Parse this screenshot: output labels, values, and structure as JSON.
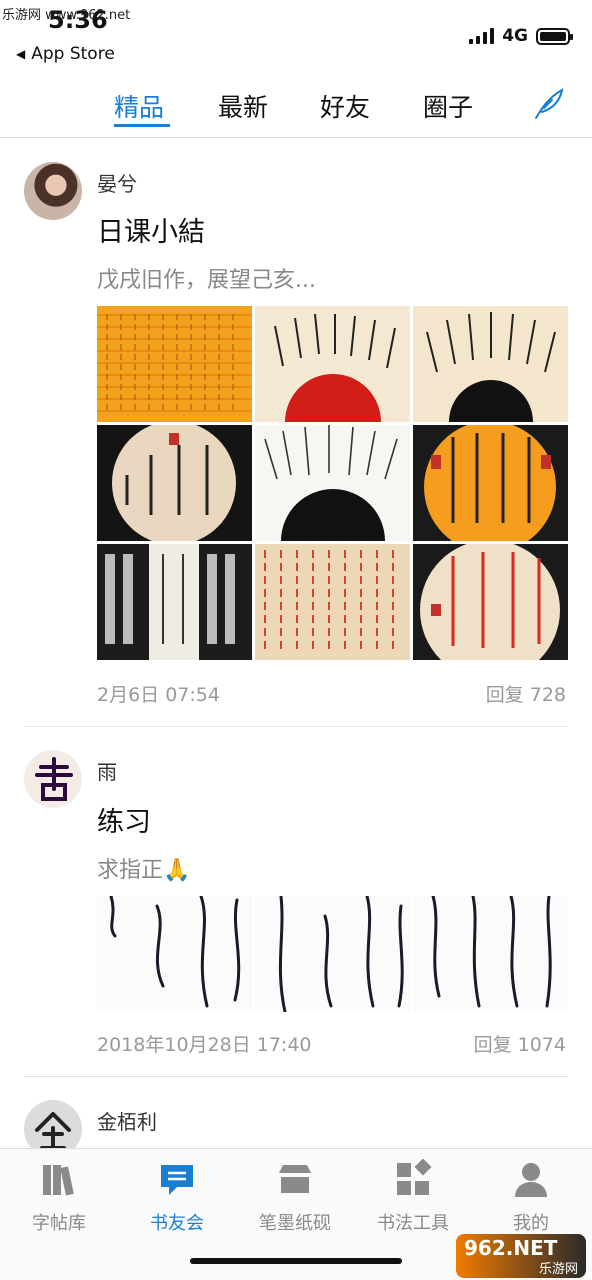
{
  "watermark": {
    "top_left": "乐游网 www.962.net",
    "bottom_right": "962.NET",
    "bottom_right_sub": "乐游网"
  },
  "status_bar": {
    "time": "5:36",
    "network": "4G",
    "back_label": "App Store"
  },
  "tabs": [
    {
      "label": "精品",
      "active": true
    },
    {
      "label": "最新",
      "active": false
    },
    {
      "label": "好友",
      "active": false
    },
    {
      "label": "圈子",
      "active": false
    }
  ],
  "compose_icon": "quill-icon",
  "accent_color": "#1a7fd4",
  "posts": [
    {
      "author": "晏兮",
      "title": "日课小結",
      "excerpt": "戊戌旧作，展望己亥...",
      "date": "2月6日 07:54",
      "replies": "回复 728",
      "images": [
        "orange-grid-calligraphy",
        "fan-calligraphy-red",
        "fan-calligraphy-black",
        "round-calligraphy-墨香",
        "fan-calligraphy-white",
        "round-calligraphy-orange",
        "black-rubbing-calligraphy",
        "red-grid-calligraphy",
        "round-calligraphy-red-text"
      ]
    },
    {
      "author": "雨",
      "title": "练习",
      "excerpt": "求指正🙏",
      "date": "2018年10月28日 17:40",
      "replies": "回复 1074",
      "images": [
        "cursive-calligraphy-1",
        "cursive-calligraphy-2",
        "cursive-calligraphy-3"
      ]
    },
    {
      "author": "金栢利"
    }
  ],
  "tabbar": [
    {
      "label": "字帖库",
      "icon": "books-icon",
      "active": false
    },
    {
      "label": "书友会",
      "icon": "chat-icon",
      "active": true
    },
    {
      "label": "笔墨纸砚",
      "icon": "store-icon",
      "active": false
    },
    {
      "label": "书法工具",
      "icon": "tools-icon",
      "active": false
    },
    {
      "label": "我的",
      "icon": "profile-icon",
      "active": false
    }
  ]
}
